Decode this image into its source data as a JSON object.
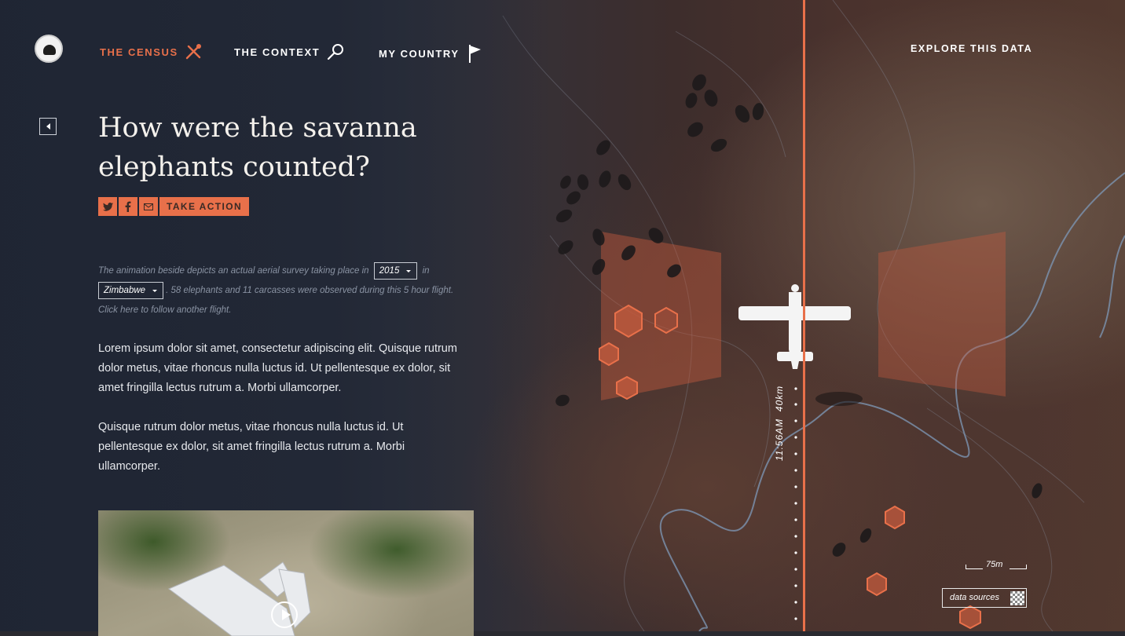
{
  "nav": {
    "items": [
      {
        "label": "THE CENSUS",
        "icon": "crossed-tools-icon",
        "active": true
      },
      {
        "label": "THE CONTEXT",
        "icon": "magnifier-icon",
        "active": false
      },
      {
        "label": "MY COUNTRY",
        "icon": "flag-icon",
        "active": false
      }
    ],
    "explore_label": "EXPLORE THIS DATA",
    "logo_icon": "elephant-seal-icon"
  },
  "page": {
    "title": "How were the savanna elephants counted?",
    "share": {
      "twitter": "twitter-icon",
      "facebook": "facebook-icon",
      "email": "email-icon",
      "action_label": "TAKE ACTION"
    },
    "intro": {
      "part1": "The animation beside depicts an actual aerial survey taking place in",
      "year": "2015",
      "part2": "in",
      "country": "Zimbabwe",
      "part3": ". 58 elephants and 11 carcasses were observed during this 5 hour flight.",
      "link": "Click here to follow another flight."
    },
    "paragraphs": [
      "Lorem ipsum dolor sit amet, consectetur adipiscing elit. Quisque rutrum dolor metus, vitae rhoncus nulla luctus id. Ut pellentesque ex dolor, sit amet fringilla lectus rutrum a. Morbi ullamcorper.",
      "Quisque rutrum dolor metus, vitae rhoncus nulla luctus id. Ut pellentesque ex dolor, sit amet fringilla lectus rutrum a. Morbi ullamcorper."
    ]
  },
  "map": {
    "flight_time": "11:56AM",
    "distance": "40km",
    "scale_label": "75m",
    "sources_label": "data sources",
    "accent_color": "#e8704a"
  }
}
